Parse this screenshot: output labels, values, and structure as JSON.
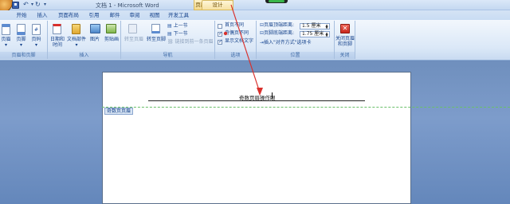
{
  "window": {
    "title": "文档 1 - Microsoft Word",
    "contextual_tools": "页眉和页脚工具",
    "quick_access": [
      "save-icon",
      "undo-icon",
      "redo-icon",
      "customize-icon"
    ]
  },
  "tabs": [
    {
      "label": "开始"
    },
    {
      "label": "插入"
    },
    {
      "label": "页面布局"
    },
    {
      "label": "引用"
    },
    {
      "label": "邮件"
    },
    {
      "label": "审阅"
    },
    {
      "label": "视图"
    },
    {
      "label": "开发工具"
    },
    {
      "label": "设计",
      "active": true
    }
  ],
  "ribbon": {
    "header_footer": {
      "label": "页眉和页脚",
      "buttons": [
        {
          "label": "页眉"
        },
        {
          "label": "页脚"
        },
        {
          "label": "页码"
        }
      ]
    },
    "insert": {
      "label": "插入",
      "buttons": [
        {
          "label": "日期和\n时间"
        },
        {
          "label": "文档部件"
        },
        {
          "label": "图片"
        },
        {
          "label": "剪贴画"
        }
      ]
    },
    "navigation": {
      "label": "导航",
      "goto_header": "转至页眉",
      "goto_footer": "转至页脚",
      "prev_section": "上一节",
      "next_section": "下一节",
      "link_previous": "链接到前一条页眉"
    },
    "options": {
      "label": "选项",
      "items": [
        {
          "label": "首页不同",
          "checked": false
        },
        {
          "label": "奇偶页不同",
          "checked": true
        },
        {
          "label": "显示文档文字",
          "checked": true
        }
      ]
    },
    "position": {
      "label": "位置",
      "header_distance_label": "页眉顶端距离:",
      "header_distance_value": "1.5 厘米",
      "footer_distance_label": "页脚底端距离:",
      "footer_distance_value": "1.75 厘米",
      "insert_align_tab": "插入\"对齐方式\"选项卡"
    },
    "close": {
      "label": "关闭",
      "button": "关闭页眉\n和页脚"
    }
  },
  "document": {
    "header_text": "奇数页眉操作眼",
    "header_section_tab": "奇数页页眉"
  },
  "colors": {
    "accent": "#15428b",
    "annotation_arrow": "#d9302c",
    "boundary": "#6abf6a"
  }
}
